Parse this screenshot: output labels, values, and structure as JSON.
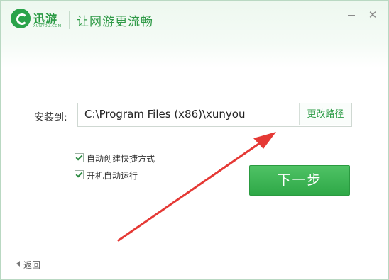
{
  "header": {
    "logo_text": "迅游",
    "logo_sub": "XUNYOU.COM",
    "slogan": "让网游更流畅",
    "minimize_label": "minimize",
    "close_label": "✕"
  },
  "install": {
    "label": "安装到:",
    "path_value": "C:\\Program Files (x86)\\xunyou",
    "change_button": "更改路径"
  },
  "options": [
    {
      "label": "自动创建快捷方式",
      "checked": true
    },
    {
      "label": "开机自动运行",
      "checked": true
    }
  ],
  "next_button": "下一步",
  "back_link": "返回",
  "colors": {
    "brand_green": "#2aa34a",
    "button_green": "#3bb556",
    "annotation_red": "#e53935"
  },
  "icons": [
    "xunyou-logo-icon",
    "minimize-icon",
    "close-icon",
    "checkbox-checked-icon",
    "back-arrow-icon",
    "annotation-arrow-icon"
  ]
}
